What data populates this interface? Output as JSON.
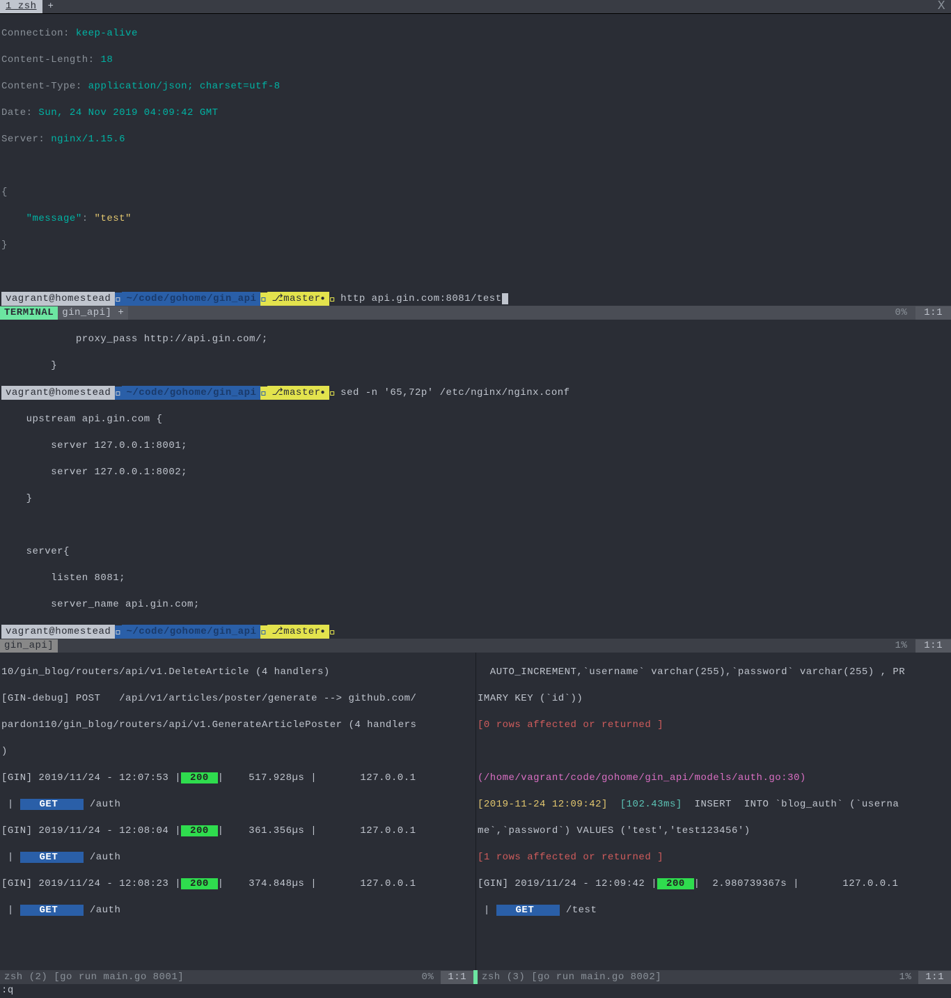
{
  "tabbar": {
    "tab1": "1 zsh",
    "plus": "+",
    "close": "X"
  },
  "http_response": {
    "l1a": "Connection",
    "l1b": ": ",
    "l1c": "keep-alive",
    "l2a": "Content-Length",
    "l2b": ": ",
    "l2c": "18",
    "l3a": "Content-Type",
    "l3b": ": ",
    "l3c": "application/json; charset=utf-8",
    "l4a": "Date",
    "l4b": ": ",
    "l4c": "Sun, 24 Nov 2019 04:09:42 GMT",
    "l5a": "Server",
    "l5b": ": ",
    "l5c": "nginx/1.15.6",
    "json_open": "{",
    "json_key": "    \"message\"",
    "json_colon": ": ",
    "json_val": "\"test\"",
    "json_close": "}"
  },
  "prompt1": {
    "user": " vagrant@homestead ",
    "path": " ~/code/gohome/gin_api ",
    "branch_icon": "",
    "branch": " master ",
    "dot": "●",
    "cmd": "http api.gin.com:8081/test"
  },
  "status1": {
    "mode": "TERMINAL",
    "tab": " gin_api]  +",
    "pct": "0%",
    "pos": "1:1"
  },
  "nginx_preview": {
    "l1": "            proxy_pass http://api.gin.com/;",
    "l2": "        }"
  },
  "prompt2": {
    "user": " vagrant@homestead ",
    "path": " ~/code/gohome/gin_api ",
    "branch": " master ",
    "dot": "●",
    "cmd": "sed -n '65,72p' /etc/nginx/nginx.conf"
  },
  "nginx_conf": {
    "l1": "    upstream api.gin.com {",
    "l2": "        server 127.0.0.1:8001;",
    "l3": "        server 127.0.0.1:8002;",
    "l4": "    }",
    "l5": "",
    "l6": "    server{",
    "l7": "        listen 8081;",
    "l8": "        server_name api.gin.com;"
  },
  "prompt3": {
    "user": " vagrant@homestead ",
    "path": " ~/code/gohome/gin_api ",
    "branch": " master ",
    "dot": "●"
  },
  "status2": {
    "tab": " gin_api]",
    "pct": "1%",
    "pos": "1:1"
  },
  "left_pane": {
    "l1": "10/gin_blog/routers/api/v1.DeleteArticle (4 handlers)",
    "l2a": "[GIN-debug] POST   /api/v1/articles/poster/generate --> github.com/",
    "l3": "pardon110/gin_blog/routers/api/v1.GenerateArticlePoster (4 handlers",
    "l4": ")",
    "r1_ts": "[GIN] 2019/11/24 - 12:07:53 ",
    "r1_sep": "|",
    "r1_200": " 200 ",
    "r1_mid": "|    517.928µs |       127.0.0.1",
    "r1_get": "  GET   ",
    "r1_path": " /auth",
    "r2_ts": "[GIN] 2019/11/24 - 12:08:04 ",
    "r2_200": " 200 ",
    "r2_mid": "|    361.356µs |       127.0.0.1",
    "r2_get": "  GET   ",
    "r2_path": " /auth",
    "r3_ts": "[GIN] 2019/11/24 - 12:08:23 ",
    "r3_200": " 200 ",
    "r3_mid": "|    374.848µs |       127.0.0.1",
    "r3_get": "  GET   ",
    "r3_path": " /auth"
  },
  "right_pane": {
    "l1": "  AUTO_INCREMENT,`username` varchar(255),`password` varchar(255) , PR",
    "l2": "IMARY KEY (`id`))",
    "l3": "[0 rows affected or returned ]",
    "l4": "",
    "l5": "(/home/vagrant/code/gohome/gin_api/models/auth.go:30)",
    "l6a": "[2019-11-24 12:09:42]  ",
    "l6b": "[102.43ms]",
    "l6c": "  INSERT  INTO `blog_auth` (`userna",
    "l7": "me`,`password`) VALUES ('test','test123456')",
    "l8": "[1 rows affected or returned ]",
    "r1_ts": "[GIN] 2019/11/24 - 12:09:42 ",
    "r1_200": " 200 ",
    "r1_mid": "|  2.980739367s |       127.0.0.1",
    "r1_get": "  GET   ",
    "r1_path": " /test"
  },
  "footer": {
    "left_name": " zsh (2) [go run main.go 8001]",
    "left_pct": "0%",
    "left_pos": "1:1",
    "right_name": " zsh (3) [go run main.go 8002]",
    "right_pct": "1%",
    "right_pos": "1:1"
  },
  "cmdline": ":q"
}
